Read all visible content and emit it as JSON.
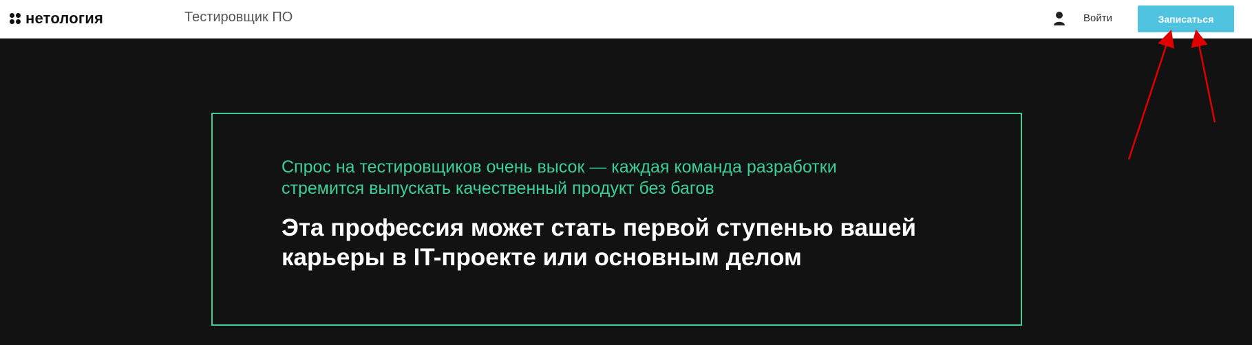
{
  "header": {
    "logo_text": "нетология",
    "course_title": "Тестировщик ПО",
    "login_label": "Войти",
    "signup_label": "Записаться",
    "user_icon": "user-icon",
    "signup_color": "#4fc3e0"
  },
  "promo": {
    "lead": "Спрос на тестировщиков очень высок — каждая команда разработки стремится выпускать качественный продукт без багов",
    "headline": "Эта профессия может стать первой ступенью вашей карьеры в IT-проекте или основным делом",
    "accent_color": "#3ccf96"
  },
  "annotations": {
    "arrow_color": "#e00000"
  }
}
